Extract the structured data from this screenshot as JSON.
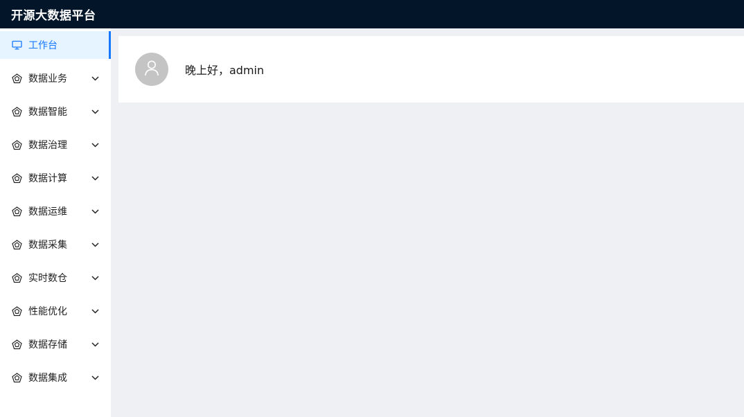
{
  "app": {
    "title": "开源大数据平台"
  },
  "colors": {
    "header_bg": "#021529",
    "active_accent": "#1677ff",
    "active_bg": "#e6f4ff",
    "content_bg": "#eef0f4",
    "avatar_bg": "#c4c4c4"
  },
  "sidebar": {
    "items": [
      {
        "label": "工作台",
        "icon": "monitor-icon",
        "active": true
      },
      {
        "label": "数据业务",
        "icon": "pentagon-icon"
      },
      {
        "label": "数据智能",
        "icon": "pentagon-icon"
      },
      {
        "label": "数据治理",
        "icon": "pentagon-icon"
      },
      {
        "label": "数据计算",
        "icon": "pentagon-icon"
      },
      {
        "label": "数据运维",
        "icon": "pentagon-icon"
      },
      {
        "label": "数据采集",
        "icon": "pentagon-icon"
      },
      {
        "label": "实时数仓",
        "icon": "pentagon-icon"
      },
      {
        "label": "性能优化",
        "icon": "pentagon-icon"
      },
      {
        "label": "数据存储",
        "icon": "pentagon-icon"
      },
      {
        "label": "数据集成",
        "icon": "pentagon-icon"
      }
    ]
  },
  "welcome": {
    "greeting": "晚上好，admin",
    "avatar_icon": "user-icon"
  }
}
